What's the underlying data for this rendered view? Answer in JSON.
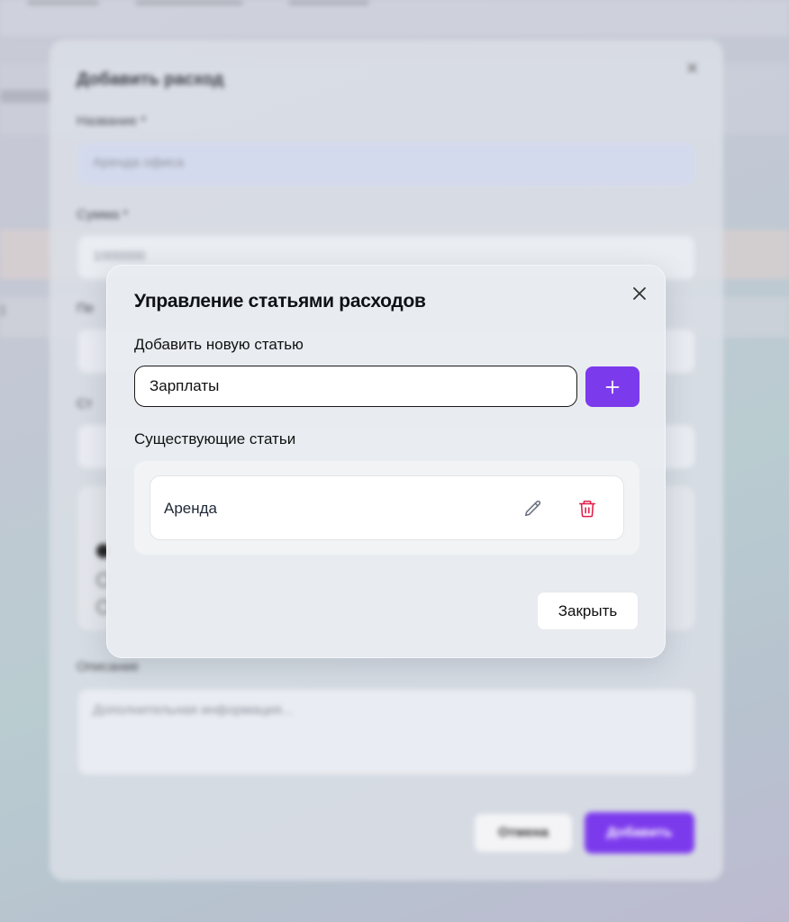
{
  "background_form": {
    "title": "Добавить расход",
    "fields": [
      {
        "label": "Название *",
        "value": "Аренда офиса"
      },
      {
        "label": "Сумма *",
        "value": "1000000"
      },
      {
        "label": "Пе",
        "value": ""
      },
      {
        "label": "Ст",
        "value": ""
      }
    ],
    "description_label": "Описание",
    "description_placeholder": "Дополнительная информация...",
    "cancel_label": "Отмена",
    "submit_label": "Добавить"
  },
  "modal": {
    "title": "Управление статьями расходов",
    "add_section_label": "Добавить новую статью",
    "new_item_value": "Зарплаты",
    "add_button_symbol": "+",
    "existing_section_label": "Существующие статьи",
    "items": [
      {
        "label": "Аренда"
      }
    ],
    "close_label": "Закрыть"
  },
  "colors": {
    "accent": "#7c3aed",
    "delete": "#e11d48",
    "edit": "#6b7280"
  },
  "icons": {
    "close": "x-icon",
    "add": "plus-icon",
    "edit": "pencil-icon",
    "delete": "trash-icon"
  }
}
